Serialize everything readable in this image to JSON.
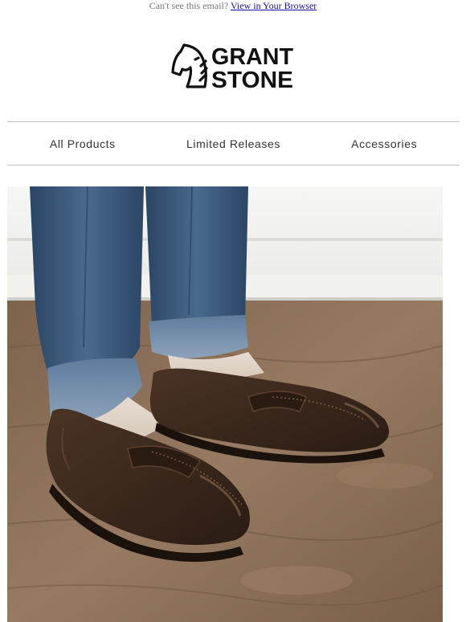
{
  "preheader": {
    "text": "Can't see this email?",
    "link": "View in Your Browser"
  },
  "brand": {
    "line1": "GRANT",
    "line2": "STONE",
    "logo_icon": "horse-head-icon"
  },
  "nav": {
    "items": [
      {
        "label": "All Products"
      },
      {
        "label": "Limited Releases"
      },
      {
        "label": "Accessories"
      }
    ]
  },
  "hero": {
    "image": "penny-loafers-photo",
    "colors": {
      "wall": "#f4f4f2",
      "floor": "#8c7058",
      "denim": "#34506f",
      "leather": "#3e2a1f"
    }
  }
}
